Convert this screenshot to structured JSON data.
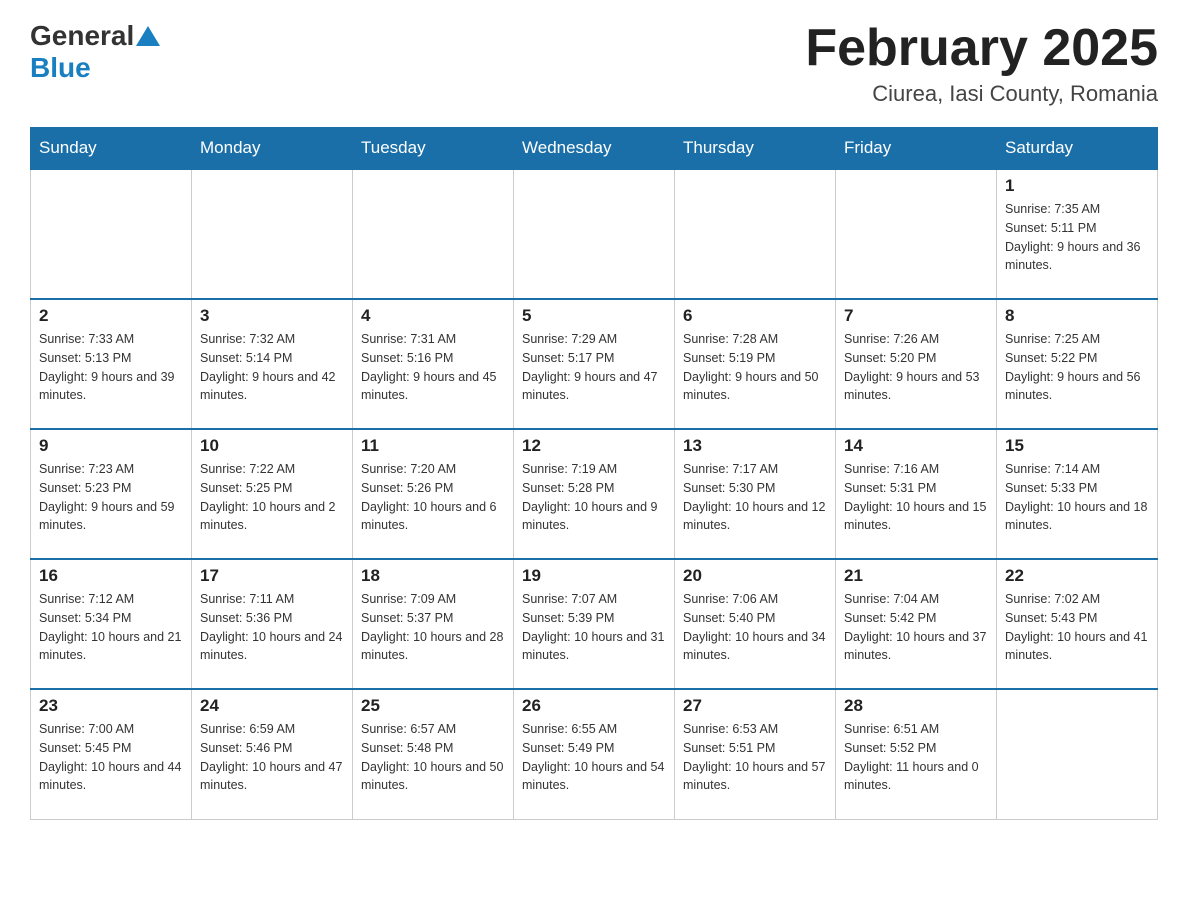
{
  "header": {
    "logo_general": "General",
    "logo_blue": "Blue",
    "month_title": "February 2025",
    "location": "Ciurea, Iasi County, Romania"
  },
  "days_of_week": [
    "Sunday",
    "Monday",
    "Tuesday",
    "Wednesday",
    "Thursday",
    "Friday",
    "Saturday"
  ],
  "weeks": [
    [
      {
        "day": "",
        "sunrise": "",
        "sunset": "",
        "daylight": ""
      },
      {
        "day": "",
        "sunrise": "",
        "sunset": "",
        "daylight": ""
      },
      {
        "day": "",
        "sunrise": "",
        "sunset": "",
        "daylight": ""
      },
      {
        "day": "",
        "sunrise": "",
        "sunset": "",
        "daylight": ""
      },
      {
        "day": "",
        "sunrise": "",
        "sunset": "",
        "daylight": ""
      },
      {
        "day": "",
        "sunrise": "",
        "sunset": "",
        "daylight": ""
      },
      {
        "day": "1",
        "sunrise": "Sunrise: 7:35 AM",
        "sunset": "Sunset: 5:11 PM",
        "daylight": "Daylight: 9 hours and 36 minutes."
      }
    ],
    [
      {
        "day": "2",
        "sunrise": "Sunrise: 7:33 AM",
        "sunset": "Sunset: 5:13 PM",
        "daylight": "Daylight: 9 hours and 39 minutes."
      },
      {
        "day": "3",
        "sunrise": "Sunrise: 7:32 AM",
        "sunset": "Sunset: 5:14 PM",
        "daylight": "Daylight: 9 hours and 42 minutes."
      },
      {
        "day": "4",
        "sunrise": "Sunrise: 7:31 AM",
        "sunset": "Sunset: 5:16 PM",
        "daylight": "Daylight: 9 hours and 45 minutes."
      },
      {
        "day": "5",
        "sunrise": "Sunrise: 7:29 AM",
        "sunset": "Sunset: 5:17 PM",
        "daylight": "Daylight: 9 hours and 47 minutes."
      },
      {
        "day": "6",
        "sunrise": "Sunrise: 7:28 AM",
        "sunset": "Sunset: 5:19 PM",
        "daylight": "Daylight: 9 hours and 50 minutes."
      },
      {
        "day": "7",
        "sunrise": "Sunrise: 7:26 AM",
        "sunset": "Sunset: 5:20 PM",
        "daylight": "Daylight: 9 hours and 53 minutes."
      },
      {
        "day": "8",
        "sunrise": "Sunrise: 7:25 AM",
        "sunset": "Sunset: 5:22 PM",
        "daylight": "Daylight: 9 hours and 56 minutes."
      }
    ],
    [
      {
        "day": "9",
        "sunrise": "Sunrise: 7:23 AM",
        "sunset": "Sunset: 5:23 PM",
        "daylight": "Daylight: 9 hours and 59 minutes."
      },
      {
        "day": "10",
        "sunrise": "Sunrise: 7:22 AM",
        "sunset": "Sunset: 5:25 PM",
        "daylight": "Daylight: 10 hours and 2 minutes."
      },
      {
        "day": "11",
        "sunrise": "Sunrise: 7:20 AM",
        "sunset": "Sunset: 5:26 PM",
        "daylight": "Daylight: 10 hours and 6 minutes."
      },
      {
        "day": "12",
        "sunrise": "Sunrise: 7:19 AM",
        "sunset": "Sunset: 5:28 PM",
        "daylight": "Daylight: 10 hours and 9 minutes."
      },
      {
        "day": "13",
        "sunrise": "Sunrise: 7:17 AM",
        "sunset": "Sunset: 5:30 PM",
        "daylight": "Daylight: 10 hours and 12 minutes."
      },
      {
        "day": "14",
        "sunrise": "Sunrise: 7:16 AM",
        "sunset": "Sunset: 5:31 PM",
        "daylight": "Daylight: 10 hours and 15 minutes."
      },
      {
        "day": "15",
        "sunrise": "Sunrise: 7:14 AM",
        "sunset": "Sunset: 5:33 PM",
        "daylight": "Daylight: 10 hours and 18 minutes."
      }
    ],
    [
      {
        "day": "16",
        "sunrise": "Sunrise: 7:12 AM",
        "sunset": "Sunset: 5:34 PM",
        "daylight": "Daylight: 10 hours and 21 minutes."
      },
      {
        "day": "17",
        "sunrise": "Sunrise: 7:11 AM",
        "sunset": "Sunset: 5:36 PM",
        "daylight": "Daylight: 10 hours and 24 minutes."
      },
      {
        "day": "18",
        "sunrise": "Sunrise: 7:09 AM",
        "sunset": "Sunset: 5:37 PM",
        "daylight": "Daylight: 10 hours and 28 minutes."
      },
      {
        "day": "19",
        "sunrise": "Sunrise: 7:07 AM",
        "sunset": "Sunset: 5:39 PM",
        "daylight": "Daylight: 10 hours and 31 minutes."
      },
      {
        "day": "20",
        "sunrise": "Sunrise: 7:06 AM",
        "sunset": "Sunset: 5:40 PM",
        "daylight": "Daylight: 10 hours and 34 minutes."
      },
      {
        "day": "21",
        "sunrise": "Sunrise: 7:04 AM",
        "sunset": "Sunset: 5:42 PM",
        "daylight": "Daylight: 10 hours and 37 minutes."
      },
      {
        "day": "22",
        "sunrise": "Sunrise: 7:02 AM",
        "sunset": "Sunset: 5:43 PM",
        "daylight": "Daylight: 10 hours and 41 minutes."
      }
    ],
    [
      {
        "day": "23",
        "sunrise": "Sunrise: 7:00 AM",
        "sunset": "Sunset: 5:45 PM",
        "daylight": "Daylight: 10 hours and 44 minutes."
      },
      {
        "day": "24",
        "sunrise": "Sunrise: 6:59 AM",
        "sunset": "Sunset: 5:46 PM",
        "daylight": "Daylight: 10 hours and 47 minutes."
      },
      {
        "day": "25",
        "sunrise": "Sunrise: 6:57 AM",
        "sunset": "Sunset: 5:48 PM",
        "daylight": "Daylight: 10 hours and 50 minutes."
      },
      {
        "day": "26",
        "sunrise": "Sunrise: 6:55 AM",
        "sunset": "Sunset: 5:49 PM",
        "daylight": "Daylight: 10 hours and 54 minutes."
      },
      {
        "day": "27",
        "sunrise": "Sunrise: 6:53 AM",
        "sunset": "Sunset: 5:51 PM",
        "daylight": "Daylight: 10 hours and 57 minutes."
      },
      {
        "day": "28",
        "sunrise": "Sunrise: 6:51 AM",
        "sunset": "Sunset: 5:52 PM",
        "daylight": "Daylight: 11 hours and 0 minutes."
      },
      {
        "day": "",
        "sunrise": "",
        "sunset": "",
        "daylight": ""
      }
    ]
  ]
}
